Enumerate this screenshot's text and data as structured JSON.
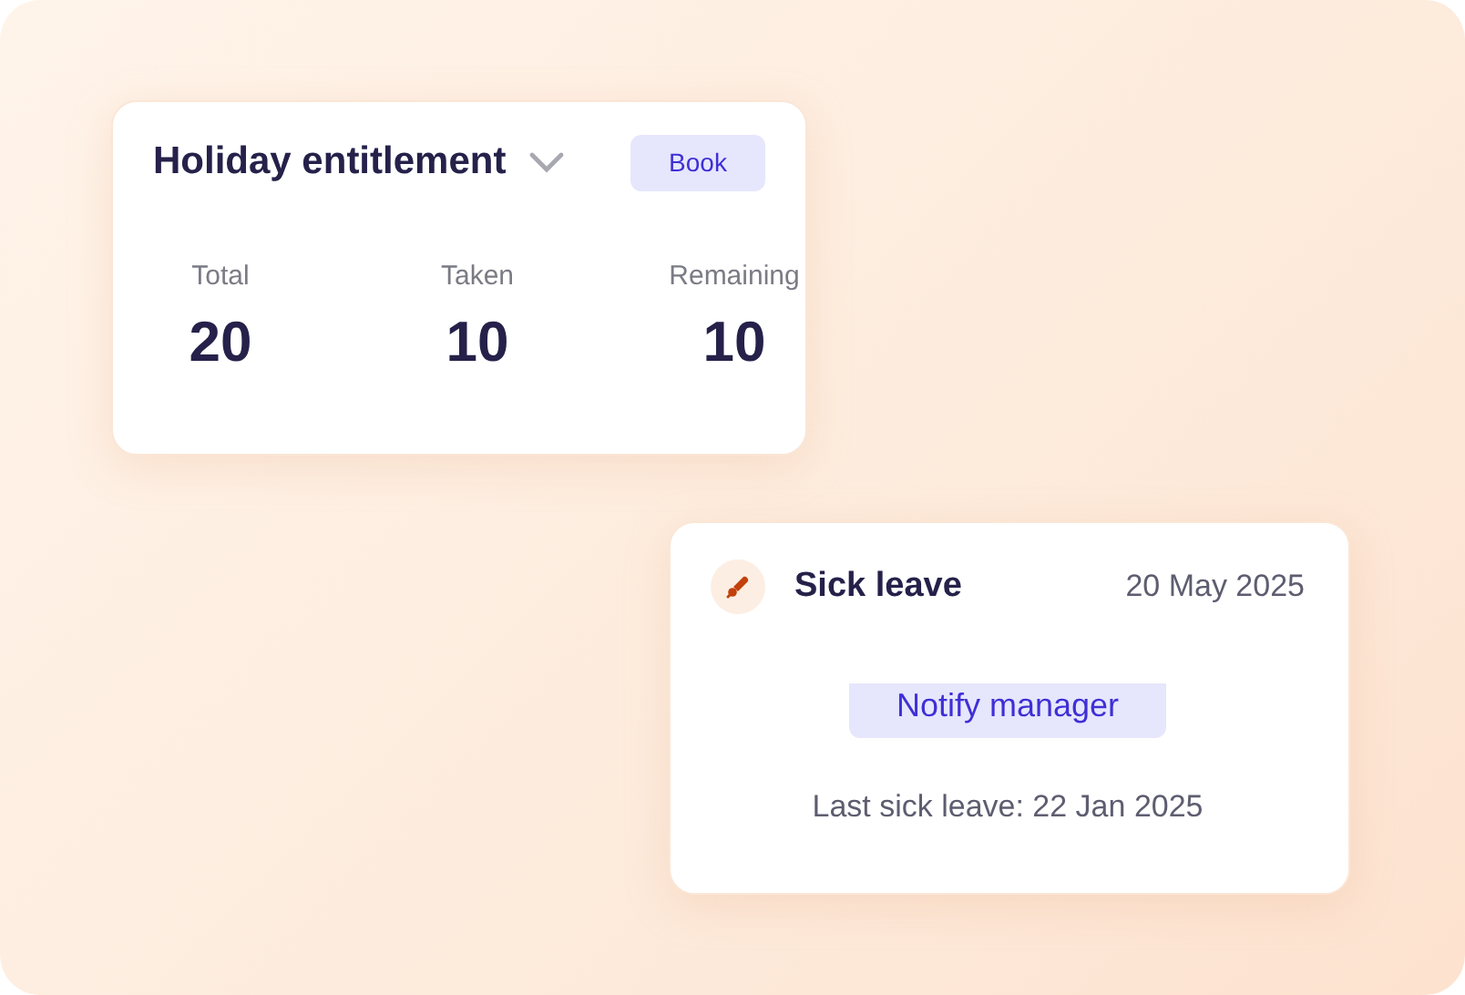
{
  "entitlement_card": {
    "title": "Holiday entitlement",
    "book_button": "Book",
    "stats": [
      {
        "label": "Total",
        "value": "20"
      },
      {
        "label": "Taken",
        "value": "10"
      },
      {
        "label": "Remaining",
        "value": "10"
      }
    ]
  },
  "sick_card": {
    "title": "Sick leave",
    "date": "20 May 2025",
    "notify_button": "Notify manager",
    "last_sick_leave": "Last sick leave: 22 Jan 2025"
  }
}
